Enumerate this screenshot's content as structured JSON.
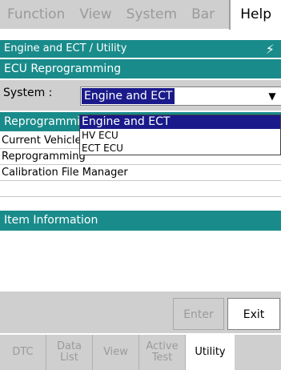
{
  "menu": {
    "items": [
      "Function",
      "View",
      "System",
      "Bar"
    ],
    "help": "Help"
  },
  "title": "Engine and ECT / Utility",
  "subtitle": "ECU Reprogramming",
  "system": {
    "label": "System :",
    "selected": "Engine and ECT",
    "options": [
      "Engine and ECT",
      "HV ECU",
      "ECT ECU"
    ]
  },
  "reprog_header": "Reprogramming",
  "list": [
    "Current Vehicle Information",
    "Reprogramming",
    "Calibration File Manager"
  ],
  "item_info": "Item Information",
  "buttons": {
    "enter": "Enter",
    "exit": "Exit"
  },
  "tabs": [
    {
      "line1": "DTC",
      "line2": ""
    },
    {
      "line1": "Data",
      "line2": "List"
    },
    {
      "line1": "View",
      "line2": ""
    },
    {
      "line1": "Active",
      "line2": "Test"
    },
    {
      "line1": "Utility",
      "line2": ""
    }
  ]
}
